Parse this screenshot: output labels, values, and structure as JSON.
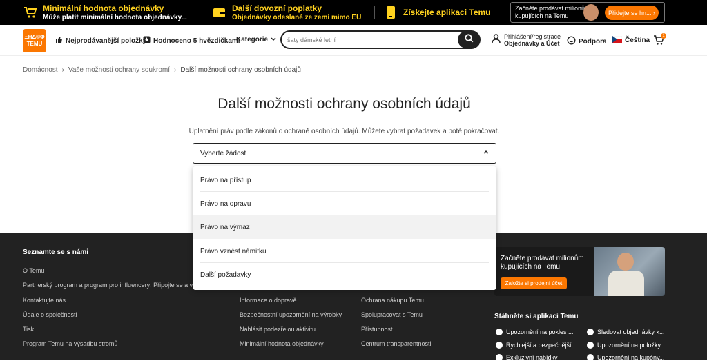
{
  "promo": {
    "min_order_title": "Minimální hodnota objednávky",
    "min_order_sub": "Může platit minimální hodnota objednávky...",
    "import_title": "Další dovozní poplatky",
    "import_sub": "Objednávky odeslané ze zemí mimo EU",
    "app_title": "Získejte aplikaci Temu",
    "sell_text": "Začněte prodávat milionům kupujících na Temu",
    "sell_button": "Přidejte se hn..."
  },
  "header": {
    "logo_top": "ΞΗΔ©Φ",
    "logo_bottom": "TEMU",
    "bestsellers": "Nejprodávanější položky",
    "five_stars": "Hodnoceno 5 hvězdičkami",
    "categories": "Kategorie",
    "search_placeholder": "šaty dámské letní",
    "account_line1": "Přihlášení/registrace",
    "account_line2": "Objednávky a Účet",
    "support": "Podpora",
    "language": "Čeština",
    "cart_count": "1"
  },
  "breadcrumb": [
    "Domácnost",
    "Vaše možnosti ochrany soukromí",
    "Další možnosti ochrany osobních údajů"
  ],
  "main": {
    "title": "Další možnosti ochrany osobních údajů",
    "description": "Uplatnění práv podle zákonů o ochraně osobních údajů. Můžete vybrat požadavek a poté pokračovat.",
    "select_value": "Vyberte žádost",
    "options": [
      "Právo na přístup",
      "Právo na opravu",
      "Právo na výmaz",
      "Právo vznést námitku",
      "Další požadavky"
    ],
    "highlighted_option": "Právo na výmaz"
  },
  "footer": {
    "col1_title": "Seznamte se s námi",
    "col1_links": [
      "O Temu",
      "Partnerský program a program pro influencery: Připojte se a vy",
      "Kontaktujte nás",
      "Údaje o společnosti",
      "Tisk",
      "Program Temu na výsadbu stromů"
    ],
    "col2_links": [
      "Informace o dopravě",
      "Bezpečnostní upozornění na výrobky",
      "Nahlásit podezřelou aktivitu",
      "Minimální hodnota objednávky"
    ],
    "col3_links": [
      "Ochrana nákupu Temu",
      "Spolupracovat s Temu",
      "Přístupnost",
      "Centrum transparentnosti"
    ],
    "banner_text": "Začněte prodávat milionům kupujících na Temu",
    "banner_button": "Založte si prodejní účet",
    "app_title": "Stáhněte si aplikaci Temu",
    "app_features": [
      "Upozornění na pokles ...",
      "Sledovat objednávky k...",
      "Rychlejší a bezpečnější ...",
      "Upozornění na položky...",
      "Exkluzivní nabídky",
      "Upozornění na kupóny..."
    ]
  },
  "colors": {
    "accent": "#fb7701",
    "promo_yellow": "#ffd21f",
    "footer_bg": "#222222"
  },
  "icons": [
    "cart-icon",
    "wallet-icon",
    "phone-icon",
    "thumb-up-icon",
    "star-badge-icon",
    "search-icon",
    "user-icon",
    "support-icon",
    "czech-flag-icon",
    "chevron-down-icon",
    "chevron-up-icon"
  ]
}
